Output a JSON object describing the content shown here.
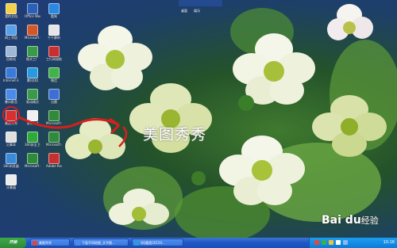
{
  "desktop": {
    "overlay_text": "美图秀秀",
    "icons": [
      {
        "label": "我的文档",
        "color": "#f2d04a"
      },
      {
        "label": "Office Word",
        "color": "#2b5fb8"
      },
      {
        "label": "酷狗",
        "color": "#2a88e0"
      },
      {
        "label": "网上邻居",
        "color": "#5aa0e8"
      },
      {
        "label": "Microsoft PowerPoint",
        "color": "#d2582a"
      },
      {
        "label": "千千静听",
        "color": "#e6e6e6"
      },
      {
        "label": "回收站",
        "color": "#9fb8d8"
      },
      {
        "label": "格式工厂",
        "color": "#3a9a4a"
      },
      {
        "label": "工行网银助手",
        "color": "#c83030"
      },
      {
        "label": "Internet Explorer",
        "color": "#3a7ad8"
      },
      {
        "label": "腾讯QQ",
        "color": "#2a9ae0"
      },
      {
        "label": "微信",
        "color": "#42b34a"
      },
      {
        "label": "暴风影音",
        "color": "#4a8ae8"
      },
      {
        "label": "驱动精灵",
        "color": "#3a9a4a"
      },
      {
        "label": "迅雷",
        "color": "#3b6fd6"
      },
      {
        "label": "美图秀秀",
        "color": "#d83030"
      },
      {
        "label": "说明.txt",
        "color": "#f0f0f0"
      },
      {
        "label": "Microsoft Office Excel",
        "color": "#2f8a3a"
      },
      {
        "label": "记事本",
        "color": "#e0e0e0"
      },
      {
        "label": "360安全卫士",
        "color": "#2faa3a"
      },
      {
        "label": "Microsoft Office Excel",
        "color": "#2f8a3a"
      },
      {
        "label": "360浏览器",
        "color": "#3a8ad8"
      },
      {
        "label": "Microsoft Excel 2003",
        "color": "#2f8a3a"
      },
      {
        "label": "Adobe Reader",
        "color": "#c83030"
      },
      {
        "label": "计算器",
        "color": "#ececec"
      }
    ]
  },
  "topbar": {
    "label1": "桌面",
    "label2": "娱乐"
  },
  "taskbar": {
    "start_label": "开始",
    "tasks": [
      {
        "label": "美图秀秀"
      },
      {
        "label": "下面不同地图_文字图..."
      },
      {
        "label": "QQ截图20150..."
      }
    ],
    "clock": "10:16"
  },
  "watermark": {
    "brand": "Bai du",
    "suffix": "经验"
  },
  "colors": {
    "accent": "#d42020",
    "taskbar": "#1f56c5",
    "tray": "#0f7ad8"
  }
}
